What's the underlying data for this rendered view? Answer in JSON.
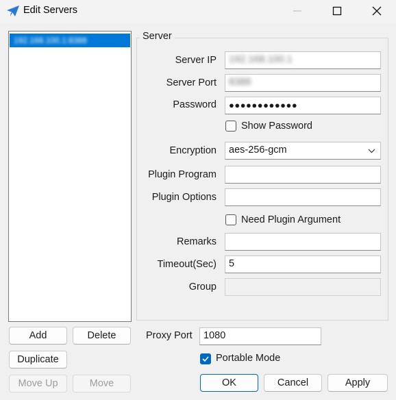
{
  "window": {
    "title": "Edit Servers",
    "icon": "paper-plane-icon"
  },
  "server_list": {
    "items": [
      {
        "label": "192.168.100.1:8388",
        "selected": true
      }
    ]
  },
  "server": {
    "group_title": "Server",
    "server_ip": {
      "label": "Server IP",
      "value": "192.168.100.1"
    },
    "server_port": {
      "label": "Server Port",
      "value": "8388"
    },
    "password": {
      "label": "Password",
      "masked_value": "●●●●●●●●●●●●"
    },
    "show_password": {
      "label": "Show Password",
      "checked": false
    },
    "encryption": {
      "label": "Encryption",
      "value": "aes-256-gcm"
    },
    "plugin_program": {
      "label": "Plugin Program",
      "value": ""
    },
    "plugin_options": {
      "label": "Plugin Options",
      "value": ""
    },
    "need_plugin_argument": {
      "label": "Need Plugin Argument",
      "checked": false
    },
    "remarks": {
      "label": "Remarks",
      "value": ""
    },
    "timeout": {
      "label": "Timeout(Sec)",
      "value": "5"
    },
    "group": {
      "label": "Group",
      "value": ""
    }
  },
  "list_buttons": {
    "add": "Add",
    "delete": "Delete",
    "duplicate": "Duplicate",
    "move_up": "Move Up",
    "move_down": "Move"
  },
  "proxy": {
    "label": "Proxy Port",
    "value": "1080"
  },
  "portable_mode": {
    "label": "Portable Mode",
    "checked": true
  },
  "dialog_buttons": {
    "ok": "OK",
    "cancel": "Cancel",
    "apply": "Apply"
  },
  "colors": {
    "accent": "#0067c0",
    "selection": "#0078d7"
  }
}
